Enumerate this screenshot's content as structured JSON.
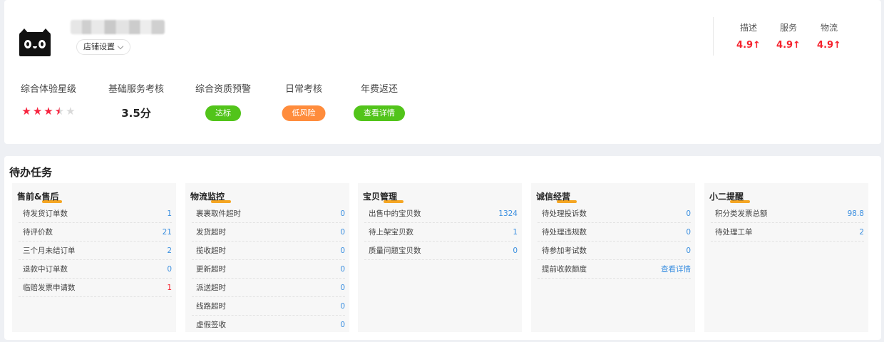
{
  "shop": {
    "settings_label": "店铺设置",
    "metrics": [
      {
        "label": "综合体验星级",
        "type": "stars",
        "rating": 3.5,
        "max": 5
      },
      {
        "label": "基础服务考核",
        "type": "text",
        "value": "3.5分"
      },
      {
        "label": "综合资质预警",
        "type": "pill",
        "value": "达标",
        "color": "#52c41a"
      },
      {
        "label": "日常考核",
        "type": "pill",
        "value": "低风险",
        "color": "#ff8c3c"
      },
      {
        "label": "年费返还",
        "type": "pill",
        "value": "查看详情",
        "color": "#52c41a"
      }
    ],
    "ratings": [
      {
        "label": "描述",
        "value": "4.9↑"
      },
      {
        "label": "服务",
        "value": "4.9↑"
      },
      {
        "label": "物流",
        "value": "4.9↑"
      }
    ]
  },
  "tasks": {
    "title": "待办任务",
    "panels": [
      {
        "title": "售前&售后",
        "rows": [
          {
            "label": "待发货订单数",
            "value": "1"
          },
          {
            "label": "待评价数",
            "value": "21"
          },
          {
            "label": "三个月未结订单",
            "value": "2"
          },
          {
            "label": "退款中订单数",
            "value": "0"
          },
          {
            "label": "临赔发票申请数",
            "value": "1",
            "alert": true
          }
        ]
      },
      {
        "title": "物流监控",
        "rows": [
          {
            "label": "裹裹取件超时",
            "value": "0"
          },
          {
            "label": "发货超时",
            "value": "0"
          },
          {
            "label": "揽收超时",
            "value": "0"
          },
          {
            "label": "更新超时",
            "value": "0"
          },
          {
            "label": "派送超时",
            "value": "0"
          },
          {
            "label": "线路超时",
            "value": "0"
          },
          {
            "label": "虚假签收",
            "value": "0"
          }
        ]
      },
      {
        "title": "宝贝管理",
        "rows": [
          {
            "label": "出售中的宝贝数",
            "value": "1324"
          },
          {
            "label": "待上架宝贝数",
            "value": "1"
          },
          {
            "label": "质量问题宝贝数",
            "value": "0"
          }
        ]
      },
      {
        "title": "诚信经营",
        "rows": [
          {
            "label": "待处理投诉数",
            "value": "0"
          },
          {
            "label": "待处理违规数",
            "value": "0"
          },
          {
            "label": "待参加考试数",
            "value": "0"
          },
          {
            "label": "提前收款额度",
            "value": "查看详情",
            "link": true
          }
        ]
      },
      {
        "title": "小二提醒",
        "rows": [
          {
            "label": "积分类发票总额",
            "value": "98.8"
          },
          {
            "label": "待处理工单",
            "value": "2"
          }
        ]
      }
    ]
  }
}
